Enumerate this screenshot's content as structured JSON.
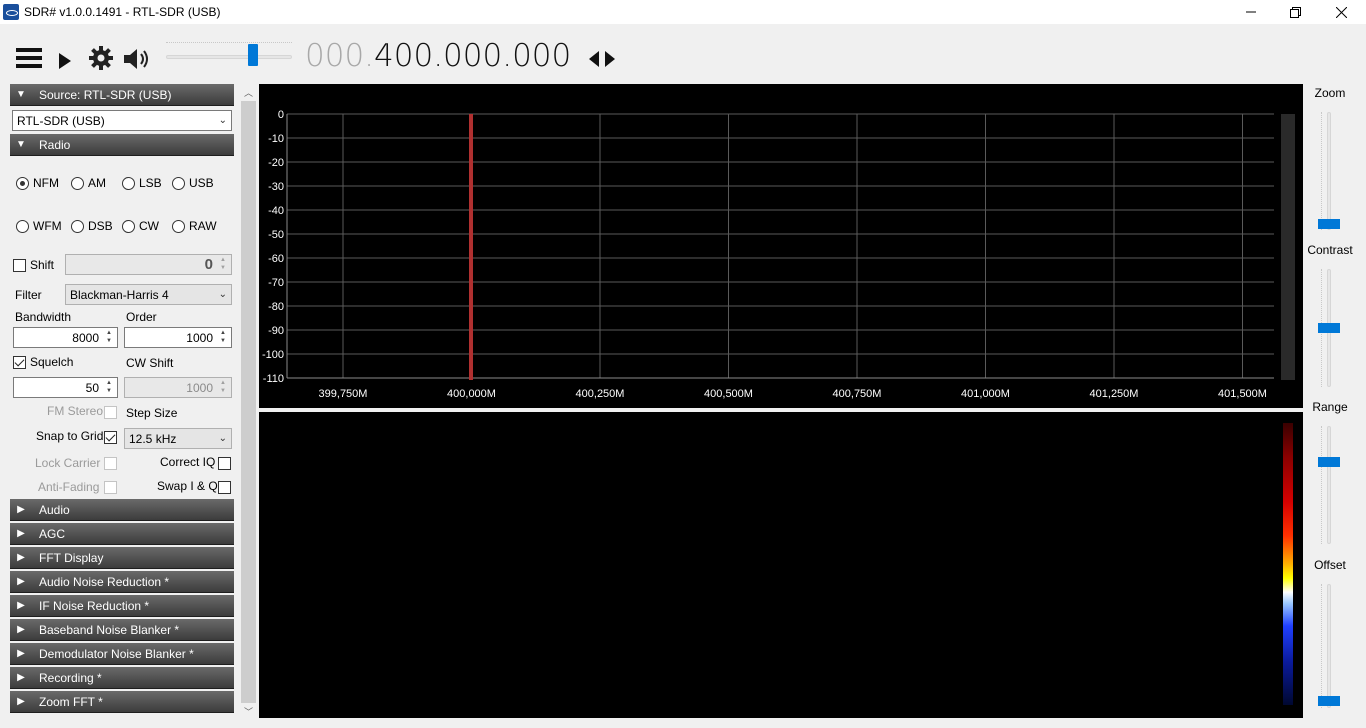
{
  "window": {
    "title": "SDR# v1.0.0.1491 - RTL-SDR (USB)"
  },
  "toolbar": {
    "frequency_dim": "000.",
    "frequency_main": "400.000.000"
  },
  "source": {
    "header": "Source: RTL-SDR (USB)",
    "device": "RTL-SDR (USB)"
  },
  "radio": {
    "header": "Radio",
    "modes": [
      "NFM",
      "AM",
      "LSB",
      "USB",
      "WFM",
      "DSB",
      "CW",
      "RAW"
    ],
    "selected_mode": "NFM",
    "shift_label": "Shift",
    "shift_value": "0",
    "filter_label": "Filter",
    "filter_value": "Blackman-Harris 4",
    "bandwidth_label": "Bandwidth",
    "bandwidth_value": "8000",
    "order_label": "Order",
    "order_value": "1000",
    "squelch_label": "Squelch",
    "squelch_value": "50",
    "cw_shift_label": "CW Shift",
    "cw_shift_value": "1000",
    "fm_stereo_label": "FM Stereo",
    "step_size_label": "Step Size",
    "snap_label": "Snap to Grid",
    "step_size_value": "12.5 kHz",
    "lock_carrier_label": "Lock Carrier",
    "correct_iq_label": "Correct IQ",
    "anti_fading_label": "Anti-Fading",
    "swap_iq_label": "Swap I & Q"
  },
  "sections": [
    "Audio",
    "AGC",
    "FFT Display",
    "Audio Noise Reduction *",
    "IF Noise Reduction *",
    "Baseband Noise Blanker *",
    "Demodulator Noise Blanker *",
    "Recording *",
    "Zoom FFT *"
  ],
  "spectrum": {
    "y_labels": [
      "0",
      "-10",
      "-20",
      "-30",
      "-40",
      "-50",
      "-60",
      "-70",
      "-80",
      "-90",
      "-100",
      "-110"
    ],
    "x_labels": [
      "399,750M",
      "400,000M",
      "400,250M",
      "400,500M",
      "400,750M",
      "401,000M",
      "401,250M",
      "401,500M"
    ],
    "marker_color": "#b03030"
  },
  "right_controls": {
    "zoom_label": "Zoom",
    "contrast_label": "Contrast",
    "range_label": "Range",
    "offset_label": "Offset",
    "accent": "#0078d7"
  }
}
